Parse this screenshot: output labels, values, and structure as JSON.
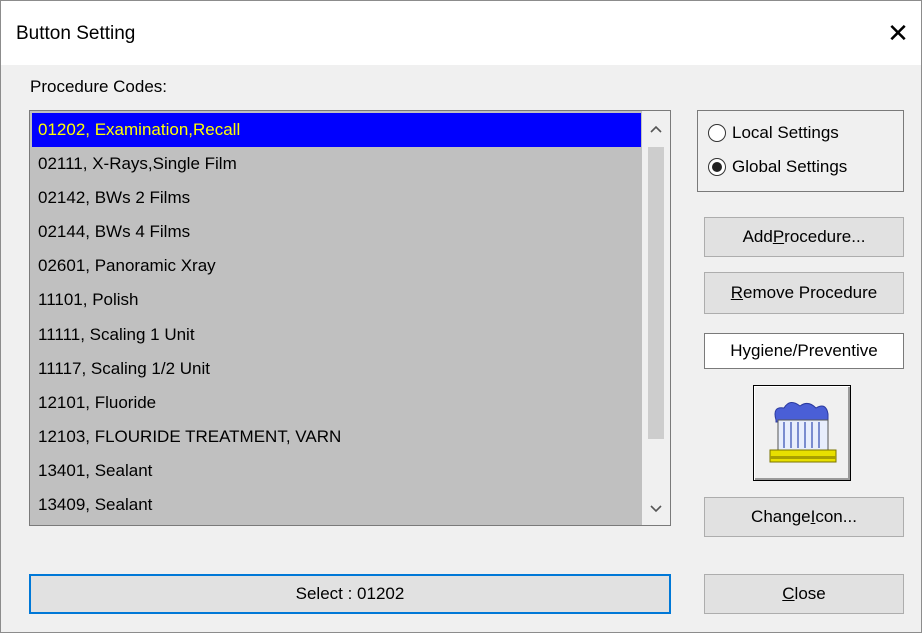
{
  "window": {
    "title": "Button Setting",
    "close_glyph": "✕"
  },
  "procedure_codes": {
    "label": "Procedure Codes:",
    "items": [
      "01202, Examination,Recall",
      "02111, X-Rays,Single Film",
      "02142, BWs 2 Films",
      "02144, BWs 4 Films",
      "02601, Panoramic Xray",
      "11101, Polish",
      "11111, Scaling 1 Unit",
      "11117, Scaling 1/2 Unit",
      "12101, Fluoride",
      "12103, FLOURIDE TREATMENT, VARN",
      "13401, Sealant",
      "13409, Sealant"
    ],
    "selected_index": 0,
    "scroll_up_glyph": "^",
    "scroll_down_glyph": "v"
  },
  "settings": {
    "local_label": "Local Settings",
    "global_label": "Global Settings",
    "selected": "global"
  },
  "buttons": {
    "add_procedure": {
      "pre": "Add ",
      "mnemonic": "P",
      "post": "rocedure..."
    },
    "remove_procedure": {
      "pre": "",
      "mnemonic": "R",
      "post": "emove Procedure"
    },
    "change_icon": {
      "pre": "Change ",
      "mnemonic": "I",
      "post": "con..."
    },
    "close": {
      "pre": "",
      "mnemonic": "C",
      "post": "lose"
    },
    "select": "Select :  01202"
  },
  "category": "Hygiene/Preventive",
  "icon": {
    "name": "toothbrush-icon"
  },
  "colors": {
    "selection_bg": "#0000ff",
    "selection_text": "#ffff00",
    "list_bg": "#c0c0c0",
    "focus_border": "#0078d7"
  }
}
